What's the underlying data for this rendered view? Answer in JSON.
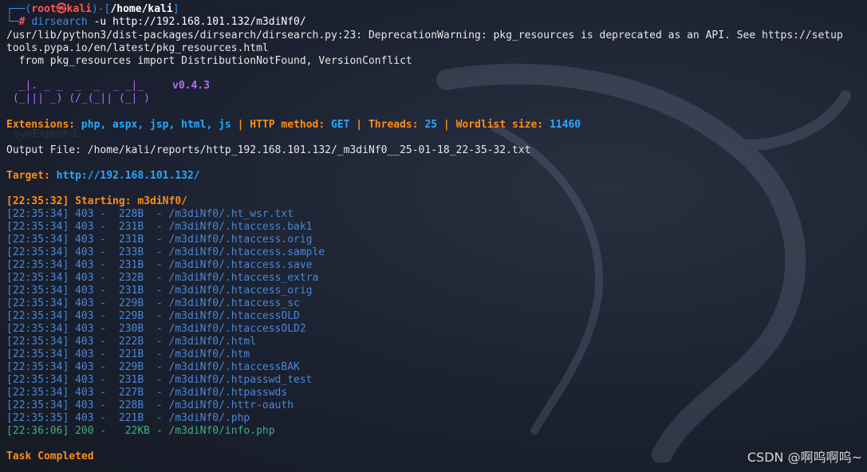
{
  "prompt": {
    "corner_top": "┌──(",
    "user": "root",
    "at": "㉿",
    "host": "kali",
    "mid": ")-[",
    "path": "/home/kali",
    "close": "]",
    "corner_bottom": "└─",
    "hash": "#",
    "command": "dirsearch",
    "args": " -u http://192.168.101.132/m3diNf0/"
  },
  "warning": {
    "line1": "/usr/lib/python3/dist-packages/dirsearch/dirsearch.py:23: DeprecationWarning: pkg_resources is deprecated as an API. See https://setup",
    "line2": "tools.pypa.io/en/latest/pkg_resources.html",
    "line3": "  from pkg_resources import DistributionNotFound, VersionConflict"
  },
  "banner": {
    "art1": "  _|. _ _  _  _  _ _|_",
    "art2": " (_||| _) (/_(_|| (_| )",
    "version": "v0.4.3"
  },
  "config": {
    "ext_label": "Extensions: ",
    "ext_value": "php, aspx, jsp, html, js",
    "method_label": "HTTP method: ",
    "method_value": "GET",
    "threads_label": "Threads: ",
    "threads_value": "25",
    "wordlist_label": "Wordlist size: ",
    "wordlist_value": "11460",
    "pipe": " | "
  },
  "output_file": "Output File: /home/kali/reports/http_192.168.101.132/_m3diNf0__25-01-18_22-35-32.txt",
  "ghost_text": "synExploit-1",
  "target": {
    "label": "Target: ",
    "url": "http://192.168.101.132/"
  },
  "starting": "[22:35:32] Starting: m3diNf0/",
  "results": [
    "[22:35:34] 403 -  228B  - /m3diNf0/.ht_wsr.txt",
    "[22:35:34] 403 -  231B  - /m3diNf0/.htaccess.bak1",
    "[22:35:34] 403 -  231B  - /m3diNf0/.htaccess.orig",
    "[22:35:34] 403 -  233B  - /m3diNf0/.htaccess.sample",
    "[22:35:34] 403 -  231B  - /m3diNf0/.htaccess.save",
    "[22:35:34] 403 -  232B  - /m3diNf0/.htaccess_extra",
    "[22:35:34] 403 -  231B  - /m3diNf0/.htaccess_orig",
    "[22:35:34] 403 -  229B  - /m3diNf0/.htaccess_sc",
    "[22:35:34] 403 -  229B  - /m3diNf0/.htaccessOLD",
    "[22:35:34] 403 -  230B  - /m3diNf0/.htaccessOLD2",
    "[22:35:34] 403 -  222B  - /m3diNf0/.html",
    "[22:35:34] 403 -  221B  - /m3diNf0/.htm",
    "[22:35:34] 403 -  229B  - /m3diNf0/.htaccessBAK",
    "[22:35:34] 403 -  231B  - /m3diNf0/.htpasswd_test",
    "[22:35:34] 403 -  227B  - /m3diNf0/.htpasswds",
    "[22:35:34] 403 -  228B  - /m3diNf0/.httr-oauth",
    "[22:35:35] 403 -  221B  - /m3diNf0/.php",
    "[22:36:06] 200 -   22KB - /m3diNf0/info.php"
  ],
  "task_completed": "Task Completed",
  "watermark": "CSDN @啊呜啊呜~"
}
